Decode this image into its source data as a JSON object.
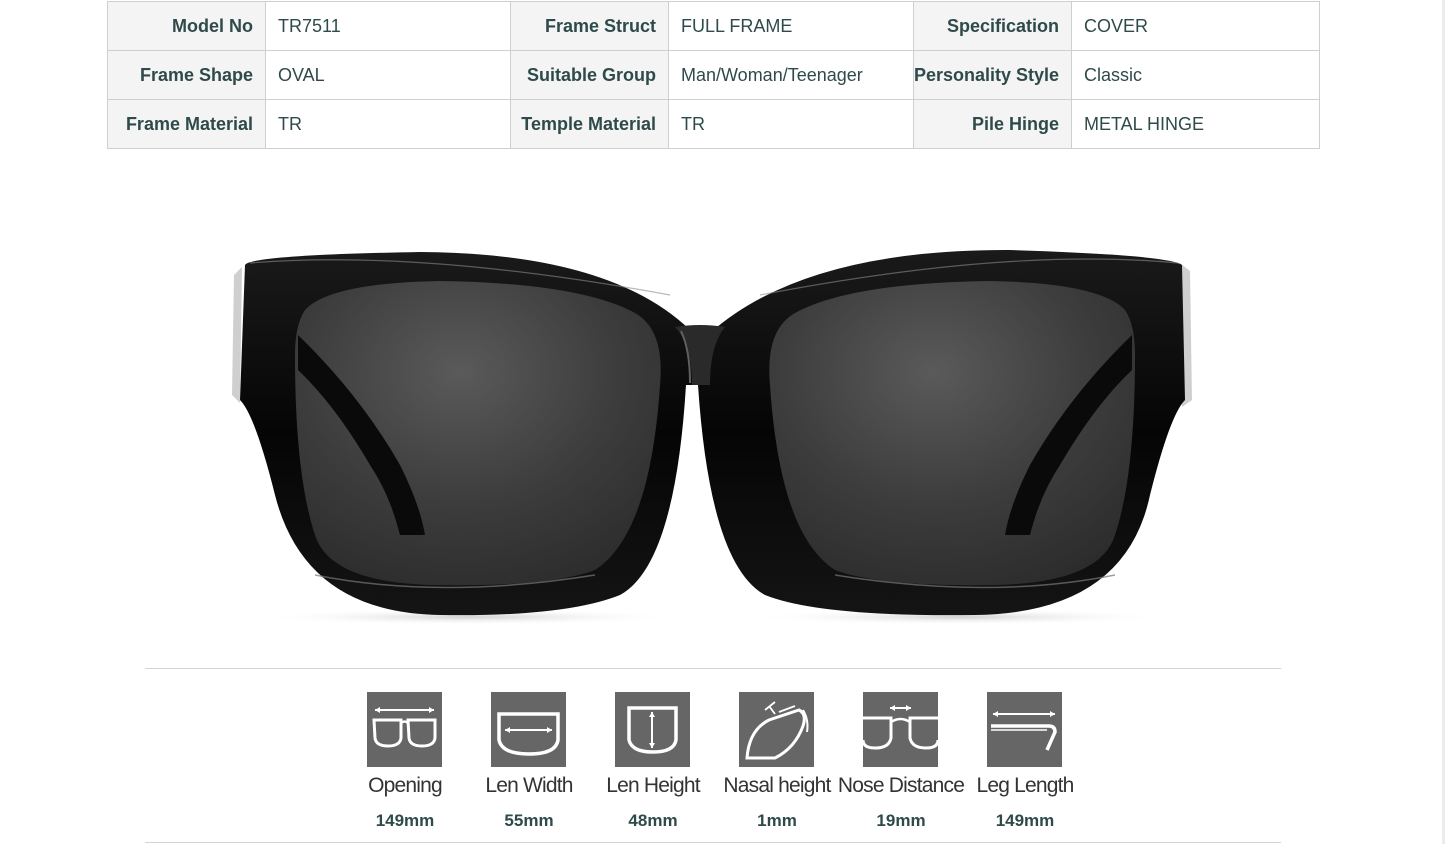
{
  "spec_table": [
    [
      {
        "key": "Model No",
        "value": "TR7511"
      },
      {
        "key": "Frame Struct",
        "value": "FULL FRAME"
      },
      {
        "key": "Specification",
        "value": "COVER"
      }
    ],
    [
      {
        "key": "Frame Shape",
        "value": "OVAL"
      },
      {
        "key": "Suitable Group",
        "value": "Man/Woman/Teenager"
      },
      {
        "key": "Personality Style",
        "value": "Classic"
      }
    ],
    [
      {
        "key": "Frame Material",
        "value": "TR"
      },
      {
        "key": "Temple Material",
        "value": "TR"
      },
      {
        "key": "Pile Hinge",
        "value": "METAL HINGE"
      }
    ]
  ],
  "product_image": {
    "subject": "black-sunglasses",
    "frame_color": "#0c0c0c",
    "lens_color": "#3a3a3a"
  },
  "measurements": [
    {
      "label": "Opening",
      "value": "149mm",
      "icon": "frame-opening-icon"
    },
    {
      "label": "Len Width",
      "value": "55mm",
      "icon": "lens-width-icon"
    },
    {
      "label": "Len Height",
      "value": "48mm",
      "icon": "lens-height-icon"
    },
    {
      "label": "Nasal height",
      "value": "1mm",
      "icon": "nasal-height-icon"
    },
    {
      "label": "Nose Distance",
      "value": "19mm",
      "icon": "nose-distance-icon"
    },
    {
      "label": "Leg Length",
      "value": "149mm",
      "icon": "leg-length-icon"
    }
  ],
  "colors": {
    "text": "#2f4a4a",
    "key_bg": "#f4f4f4",
    "border": "#cfcfcf",
    "icon_bg": "#666666"
  }
}
